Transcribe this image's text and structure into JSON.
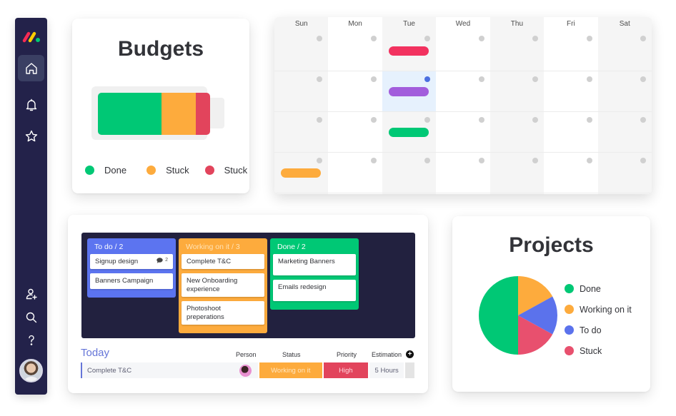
{
  "sidebar": {
    "logo": "monday-logo",
    "top_items": [
      {
        "name": "home",
        "icon": "home-icon",
        "active": true
      },
      {
        "name": "notifications",
        "icon": "bell-icon",
        "active": false
      },
      {
        "name": "favorites",
        "icon": "star-icon",
        "active": false
      }
    ],
    "bottom_items": [
      {
        "name": "invite",
        "icon": "add-user-icon"
      },
      {
        "name": "search",
        "icon": "search-icon"
      },
      {
        "name": "help",
        "icon": "help-icon"
      }
    ],
    "avatar": "user-avatar"
  },
  "budgets": {
    "title": "Budgets",
    "segments": [
      {
        "label": "Done",
        "share": 0.57,
        "color": "#00c875"
      },
      {
        "label": "Stuck",
        "share": 0.3,
        "color": "#fdab3d"
      },
      {
        "label": "Stuck",
        "share": 0.13,
        "color": "#e2445c"
      }
    ]
  },
  "calendar": {
    "days": [
      "Sun",
      "Mon",
      "Tue",
      "Wed",
      "Thu",
      "Fri",
      "Sat"
    ],
    "weeks": 4,
    "today": {
      "week": 1,
      "day": 2
    },
    "events": [
      {
        "week": 0,
        "day": 2,
        "color": "#f2325f"
      },
      {
        "week": 1,
        "day": 2,
        "color": "#a25ddc"
      },
      {
        "week": 2,
        "day": 2,
        "color": "#00c875"
      },
      {
        "week": 3,
        "day": 0,
        "color": "#fdab3d"
      }
    ]
  },
  "kanban": {
    "columns": [
      {
        "title": "To do / 2",
        "color": "#579bfc",
        "items": [
          {
            "text": "Signup design",
            "comments": "2"
          },
          {
            "text": "Banners Campaign"
          }
        ]
      },
      {
        "title": "Working on it / 3",
        "color": "#fdab3d",
        "items": [
          {
            "text": "Complete T&C"
          },
          {
            "text": "New Onboarding experience"
          },
          {
            "text": "Photoshoot preperations"
          }
        ]
      },
      {
        "title": "Done / 2",
        "color": "#00c875",
        "items": [
          {
            "text": "Marketing Banners"
          },
          {
            "text": "Emails redesign"
          }
        ]
      }
    ]
  },
  "today_table": {
    "title": "Today",
    "headers": {
      "person": "Person",
      "status": "Status",
      "priority": "Priority",
      "estimation": "Estimation"
    },
    "add_column_icon": "plus-icon",
    "rows": [
      {
        "item": "Complete T&C",
        "person": "person-avatar",
        "status": "Working on it",
        "priority": "High",
        "estimation": "5 Hours"
      }
    ]
  },
  "projects": {
    "title": "Projects",
    "chart_data": {
      "type": "pie",
      "title": "Projects",
      "legend_position": "right",
      "slices": [
        {
          "label": "Done",
          "value": 50,
          "color": "#00c875"
        },
        {
          "label": "Working on it",
          "value": 17,
          "color": "#fdab3d"
        },
        {
          "label": "To do",
          "value": 16,
          "color": "#5b72ec"
        },
        {
          "label": "Stuck",
          "value": 17,
          "color": "#e8506e"
        }
      ]
    }
  }
}
